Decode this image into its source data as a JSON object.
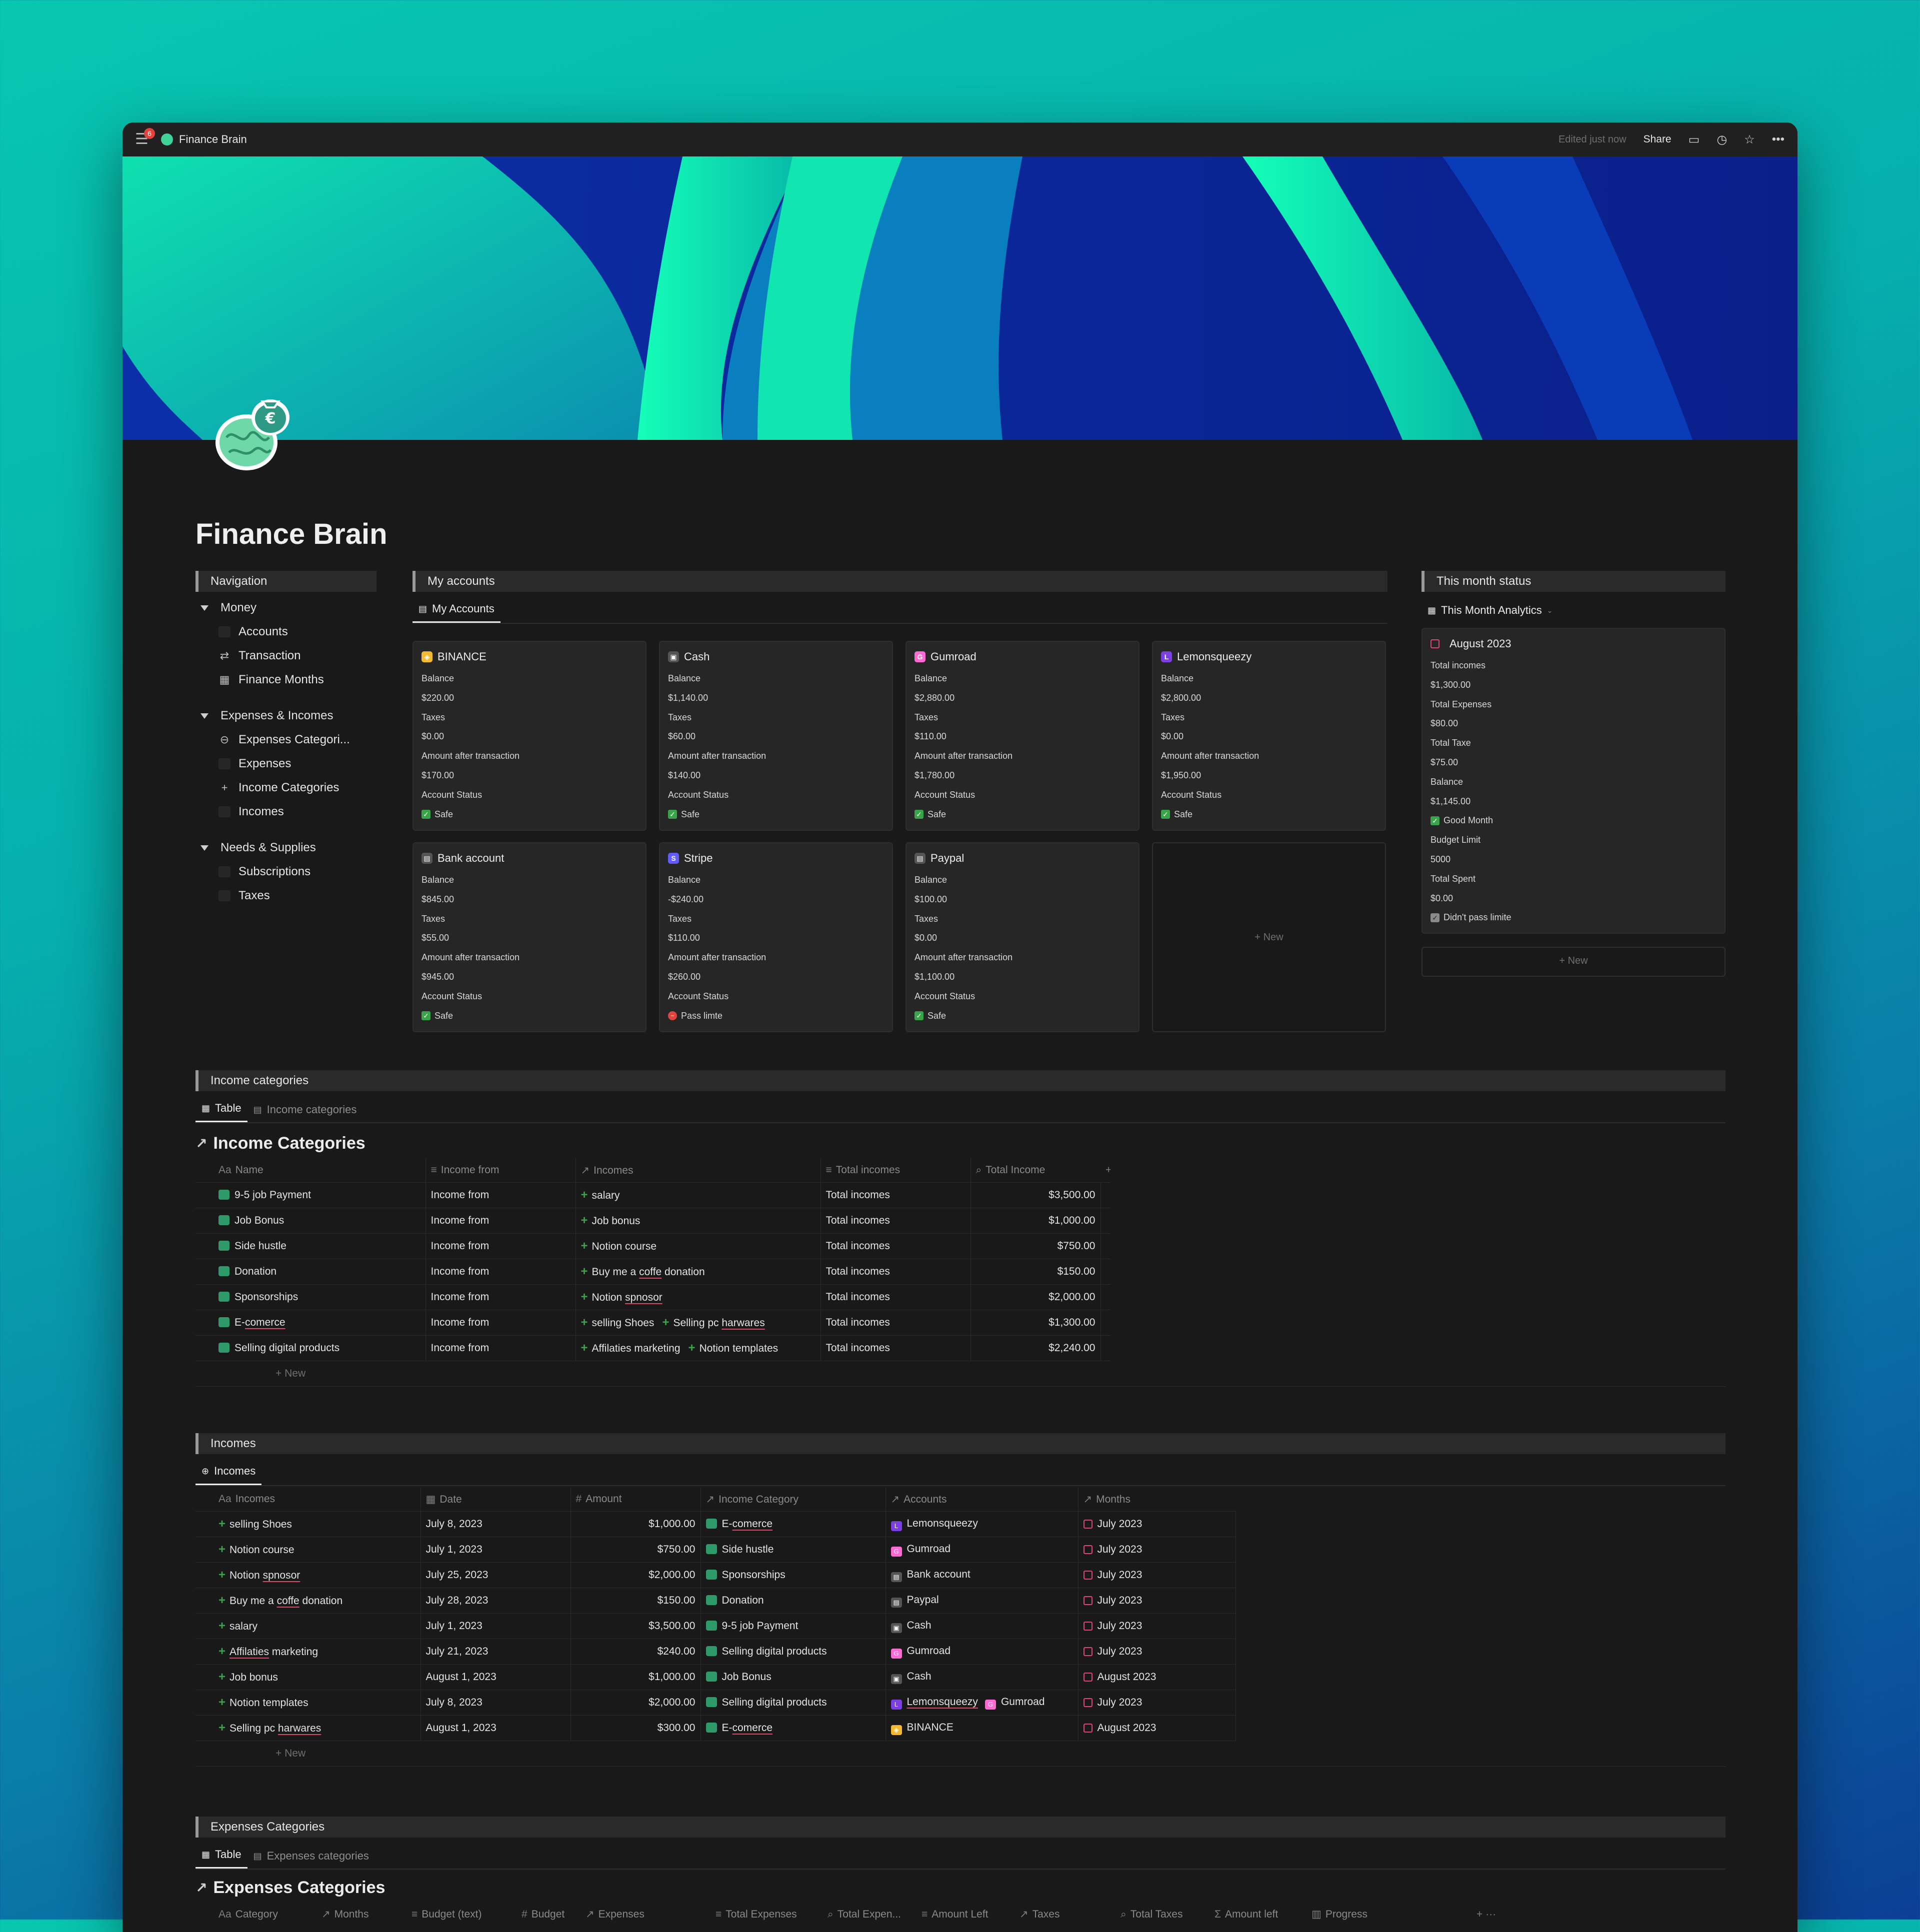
{
  "topbar": {
    "badge": "6",
    "page_title": "Finance Brain",
    "edited": "Edited just now",
    "share": "Share"
  },
  "page": {
    "title": "Finance Brain"
  },
  "navigation": {
    "heading": "Navigation",
    "groups": [
      {
        "label": "Money",
        "items": [
          "Accounts",
          "Transaction",
          "Finance Months"
        ]
      },
      {
        "label": "Expenses & Incomes",
        "items": [
          "Expenses Categori...",
          "Expenses",
          "Income Categories",
          "Incomes"
        ]
      },
      {
        "label": "Needs & Supplies",
        "items": [
          "Subscriptions",
          "Taxes"
        ]
      }
    ]
  },
  "accounts": {
    "heading": "My accounts",
    "tab": "My Accounts",
    "labels": {
      "balance": "Balance",
      "taxes": "Taxes",
      "after": "Amount after transaction",
      "status": "Account Status"
    },
    "new": "New",
    "cards": [
      {
        "name": "BINANCE",
        "balance": "$220.00",
        "taxes": "$0.00",
        "after": "$170.00",
        "status": "Safe",
        "logo_color": "#f3ba2f",
        "logo_glyph": "◈"
      },
      {
        "name": "Cash",
        "balance": "$1,140.00",
        "taxes": "$60.00",
        "after": "$140.00",
        "status": "Safe",
        "logo_color": "#555555",
        "logo_glyph": "▣"
      },
      {
        "name": "Gumroad",
        "balance": "$2,880.00",
        "taxes": "$110.00",
        "after": "$1,780.00",
        "status": "Safe",
        "logo_color": "#ff6ad5",
        "logo_glyph": "G"
      },
      {
        "name": "Lemonsqueezy",
        "balance": "$2,800.00",
        "taxes": "$0.00",
        "after": "$1,950.00",
        "status": "Safe",
        "logo_color": "#7b3fe4",
        "logo_glyph": "L"
      },
      {
        "name": "Bank account",
        "balance": "$845.00",
        "taxes": "$55.00",
        "after": "$945.00",
        "status": "Safe",
        "logo_color": "#555555",
        "logo_glyph": "▤"
      },
      {
        "name": "Stripe",
        "balance": "-$240.00",
        "taxes": "$110.00",
        "after": "$260.00",
        "status": "Pass limte",
        "logo_color": "#635bff",
        "logo_glyph": "S"
      },
      {
        "name": "Paypal",
        "balance": "$100.00",
        "taxes": "$0.00",
        "after": "$1,100.00",
        "status": "Safe",
        "logo_color": "#555555",
        "logo_glyph": "▤"
      }
    ]
  },
  "month_status": {
    "heading": "This month status",
    "view": "This Month Analytics",
    "card": {
      "title": "August 2023",
      "rows": [
        "Total incomes",
        "$1,300.00",
        "Total Expenses",
        "$80.00",
        "Total Taxe",
        "$75.00",
        "Balance",
        "$1,145.00"
      ],
      "good": "Good Month",
      "rows2": [
        "Budget Limit",
        "5000",
        "Total Spent",
        "$0.00"
      ],
      "limit": "Didn't pass limite"
    },
    "new": "New"
  },
  "income_categories": {
    "heading": "Income categories",
    "tabs": [
      "Table",
      "Income categories"
    ],
    "db_title": "Income Categories",
    "columns": [
      "Name",
      "Income from",
      "Incomes",
      "Total incomes",
      "Total Income"
    ],
    "rows": [
      {
        "name": "9-5 job Payment",
        "from": "Income from",
        "incomes": [
          "salary"
        ],
        "total_label": "Total incomes",
        "total": "$3,500.00"
      },
      {
        "name": "Job Bonus",
        "from": "Income from",
        "incomes": [
          "Job bonus"
        ],
        "total_label": "Total incomes",
        "total": "$1,000.00"
      },
      {
        "name": "Side hustle",
        "from": "Income from",
        "incomes": [
          "Notion course"
        ],
        "total_label": "Total incomes",
        "total": "$750.00"
      },
      {
        "name": "Donation",
        "from": "Income from",
        "incomes": [
          "Buy me a coffe donation"
        ],
        "total_label": "Total incomes",
        "total": "$150.00"
      },
      {
        "name": "Sponsorships",
        "from": "Income from",
        "incomes": [
          "Notion spnosor"
        ],
        "total_label": "Total incomes",
        "total": "$2,000.00"
      },
      {
        "name": "E-comerce",
        "from": "Income from",
        "incomes": [
          "selling Shoes",
          "Selling pc harwares"
        ],
        "total_label": "Total incomes",
        "total": "$1,300.00"
      },
      {
        "name": "Selling digital products",
        "from": "Income from",
        "incomes": [
          "Affilaties marketing",
          "Notion templates"
        ],
        "total_label": "Total incomes",
        "total": "$2,240.00"
      }
    ],
    "new": "New"
  },
  "incomes": {
    "heading": "Incomes",
    "tab": "Incomes",
    "columns": [
      "Incomes",
      "Date",
      "Amount",
      "Income Category",
      "Accounts",
      "Months"
    ],
    "rows": [
      {
        "name": "selling Shoes",
        "date": "July 8, 2023",
        "amount": "$1,000.00",
        "category": "E-comerce",
        "accounts": [
          "Lemonsqueezy"
        ],
        "month": "July 2023"
      },
      {
        "name": "Notion course",
        "date": "July 1, 2023",
        "amount": "$750.00",
        "category": "Side hustle",
        "accounts": [
          "Gumroad"
        ],
        "month": "July 2023"
      },
      {
        "name": "Notion spnosor",
        "date": "July 25, 2023",
        "amount": "$2,000.00",
        "category": "Sponsorships",
        "accounts": [
          "Bank account"
        ],
        "month": "July 2023"
      },
      {
        "name": "Buy me a coffe donation",
        "date": "July 28, 2023",
        "amount": "$150.00",
        "category": "Donation",
        "accounts": [
          "Paypal"
        ],
        "month": "July 2023"
      },
      {
        "name": "salary",
        "date": "July 1, 2023",
        "amount": "$3,500.00",
        "category": "9-5 job Payment",
        "accounts": [
          "Cash"
        ],
        "month": "July 2023"
      },
      {
        "name": "Affilaties marketing",
        "date": "July 21, 2023",
        "amount": "$240.00",
        "category": "Selling digital products",
        "accounts": [
          "Gumroad"
        ],
        "month": "July 2023"
      },
      {
        "name": "Job bonus",
        "date": "August 1, 2023",
        "amount": "$1,000.00",
        "category": "Job Bonus",
        "accounts": [
          "Cash"
        ],
        "month": "August 2023"
      },
      {
        "name": "Notion templates",
        "date": "July 8, 2023",
        "amount": "$2,000.00",
        "category": "Selling digital products",
        "accounts": [
          "Lemonsqueezy",
          "Gumroad"
        ],
        "month": "July 2023"
      },
      {
        "name": "Selling pc harwares",
        "date": "August 1, 2023",
        "amount": "$300.00",
        "category": "E-comerce",
        "accounts": [
          "BINANCE"
        ],
        "month": "August 2023"
      }
    ],
    "new": "New"
  },
  "expenses_categories": {
    "heading": "Expenses Categories",
    "tabs": [
      "Table",
      "Expenses categories"
    ],
    "db_title": "Expenses Categories",
    "columns": [
      "Category",
      "Months",
      "Budget (text)",
      "Budget",
      "Expenses",
      "Total Expenses",
      "Total Expen...",
      "Amount Left",
      "Taxes",
      "Total Taxes",
      "Amount left",
      "Progress"
    ]
  }
}
